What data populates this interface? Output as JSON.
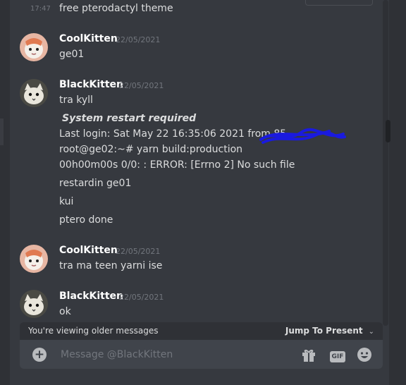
{
  "messages_above": {
    "time": "17:47",
    "text": "free pterodactyl theme"
  },
  "groups": [
    {
      "author": "CoolKitten",
      "date": "22/05/2021",
      "lines": [
        "ge01"
      ]
    },
    {
      "author": "BlackKitten",
      "date": "22/05/2021",
      "lines": [
        "tra kyll",
        "System restart required",
        "Last login: Sat May 22 16:35:06 2021 from 85",
        "root@ge02:~# yarn build:production",
        "00h00m00s 0/0: : ERROR: [Errno 2] No such file",
        "restardin ge01",
        "kui",
        "ptero done"
      ]
    },
    {
      "author": "CoolKitten",
      "date": "22/05/2021",
      "lines": [
        "tra ma teen yarni ise"
      ]
    },
    {
      "author": "BlackKitten",
      "date": "22/05/2021",
      "lines": [
        "ok"
      ]
    }
  ],
  "older_bar": {
    "text": "You're viewing older messages",
    "jump_label": "Jump To Present"
  },
  "composer": {
    "placeholder": "Message @BlackKitten"
  },
  "icons": {
    "add": "plus-circle-icon",
    "gift": "gift-icon",
    "gif": "GIF",
    "emoji": "emoji-icon"
  },
  "colors": {
    "background": "#36393f",
    "composer": "#40444b",
    "username": "#ffffff",
    "timestamp": "#72767d",
    "scribble": "#1a1adf"
  }
}
